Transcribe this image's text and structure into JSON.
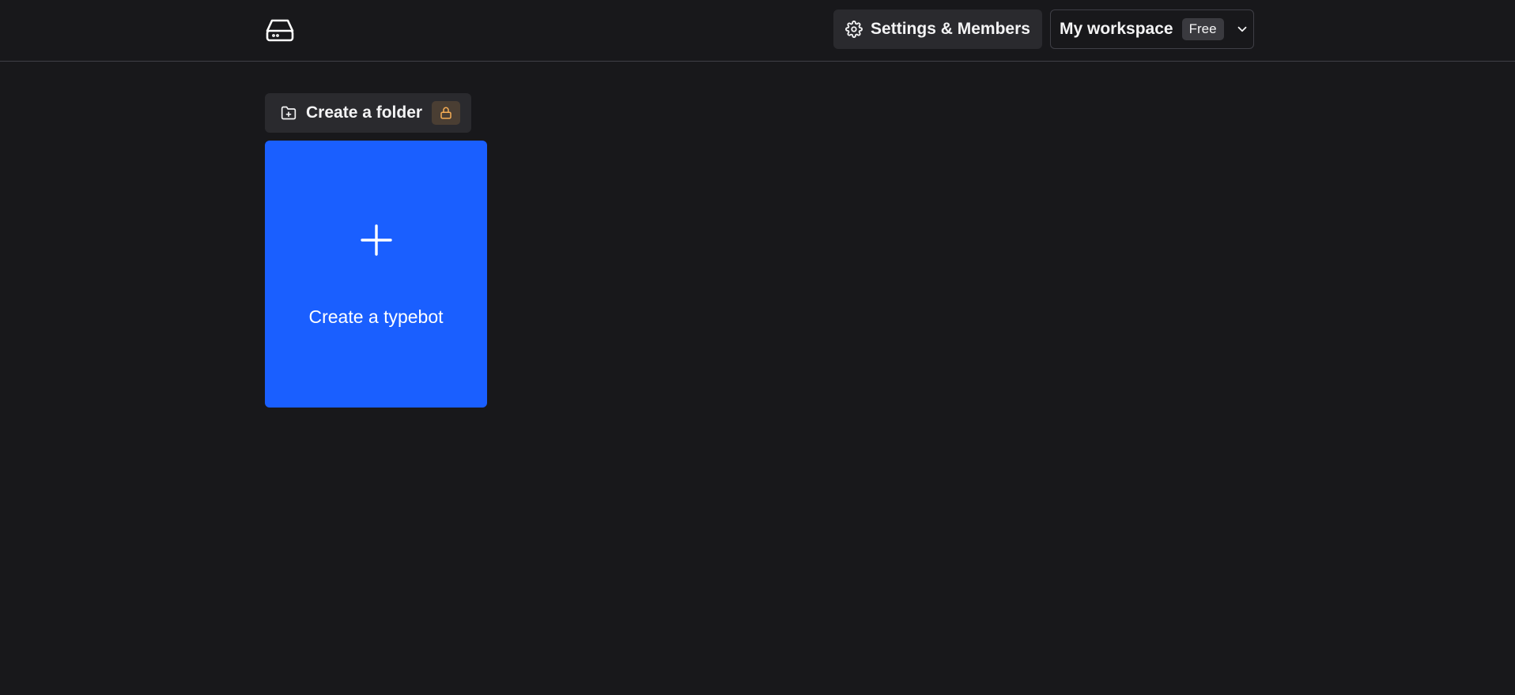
{
  "header": {
    "logo_icon": "hard-drive-icon",
    "settings_label": "Settings & Members",
    "settings_icon": "gear-icon",
    "workspace_name": "My workspace",
    "workspace_plan": "Free",
    "workspace_chevron_icon": "chevron-down-icon"
  },
  "toolbar": {
    "create_folder_label": "Create a folder",
    "folder_icon": "folder-plus-icon",
    "lock_icon": "lock-icon"
  },
  "main": {
    "create_typebot_label": "Create a typebot",
    "plus_icon": "plus-icon"
  },
  "colors": {
    "background": "#18181b",
    "accent": "#1a5fff",
    "lock_badge": "#4a3e33",
    "lock_icon": "#f6ad55"
  }
}
